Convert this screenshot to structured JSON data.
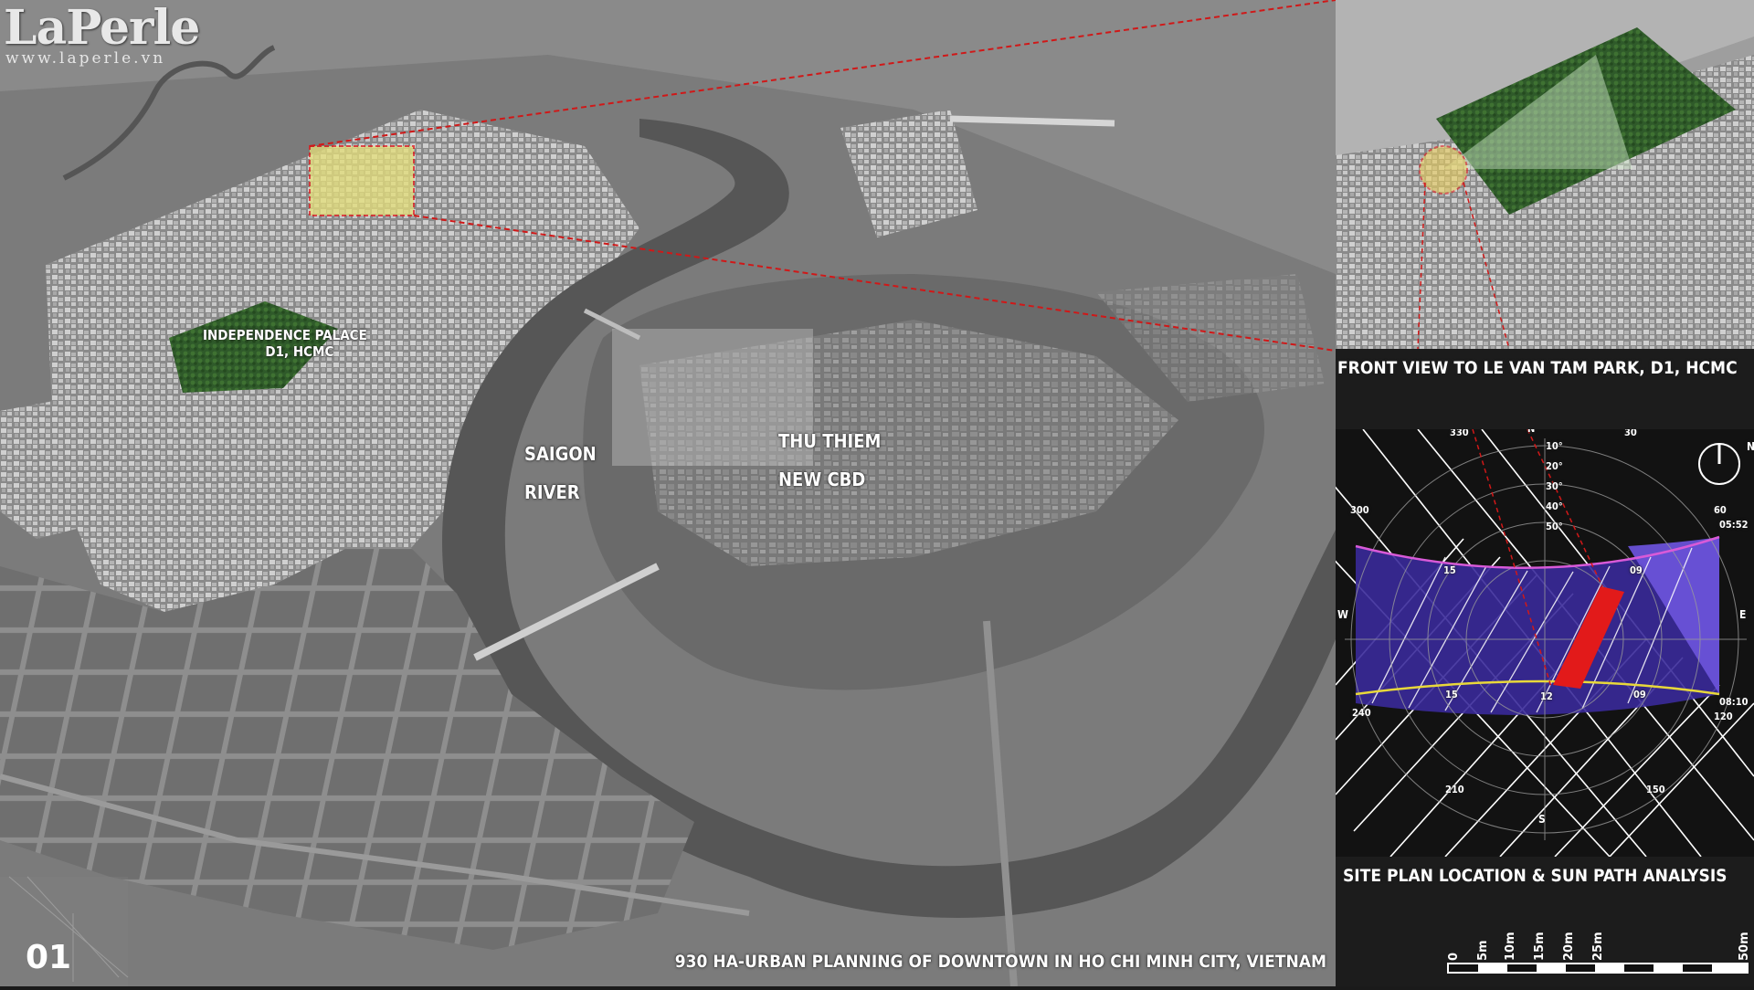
{
  "brand": {
    "name": "LaPerle",
    "url": "www.laperle.vn"
  },
  "map": {
    "labels": {
      "independence_line1": "INDEPENDENCE PALACE",
      "independence_line2": "D1, HCMC",
      "saigon_line1": "SAIGON",
      "saigon_line2": "RIVER",
      "thu_thiem_line1": "THU THIEM",
      "thu_thiem_line2": "NEW CBD"
    },
    "page_number": "01",
    "title": "930 HA-URBAN PLANNING OF DOWNTOWN IN HO CHI MINH CITY, VIETNAM"
  },
  "front_view": {
    "caption": "FRONT VIEW TO LE VAN TAM  PARK, D1, HCMC"
  },
  "sun_path": {
    "caption": "SITE PLAN LOCATION & SUN PATH ANALYSIS",
    "compass": {
      "north": "N",
      "east": "E",
      "west": "W",
      "south": "S"
    },
    "azimuth_labels": [
      "330",
      "30",
      "60",
      "120",
      "150",
      "210",
      "240",
      "300"
    ],
    "altitude_labels": [
      "10°",
      "20°",
      "30°",
      "40°",
      "50°"
    ],
    "summer_hours": [
      "15",
      "09"
    ],
    "winter_hours": [
      "15",
      "12",
      "09"
    ],
    "time_labels": [
      "05:52",
      "08:10"
    ]
  },
  "scale_bar": {
    "labels": [
      "0",
      "5m",
      "10m",
      "15m",
      "20m",
      "25m",
      "50m"
    ]
  },
  "colors": {
    "highlight_red": "#e21a1a",
    "zone_yellow": "#e6e07a",
    "sun_purple": "#3a2a9a",
    "sun_purple_light": "#6a52d8",
    "summer_path": "#d85ad8",
    "winter_path": "#e8d83a",
    "park_green": "#2f5a2a"
  }
}
